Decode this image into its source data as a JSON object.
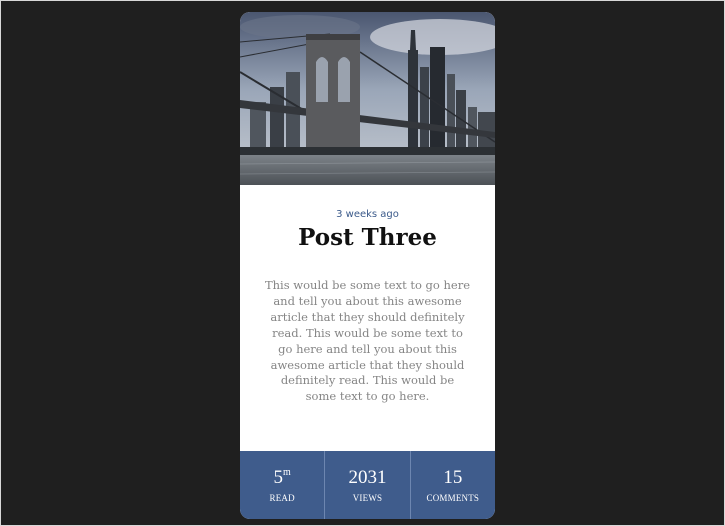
{
  "post": {
    "date": "3 weeks ago",
    "title": "Post Three",
    "body": "This would be some text to go here and tell you about this awesome article that they should definitely read. This would be some text to go here and tell you about this awesome article that they should definitely read. This would be some text to go here."
  },
  "stats": [
    {
      "value": "5",
      "unit": "m",
      "label": "READ"
    },
    {
      "value": "2031",
      "label": "VIEWS"
    },
    {
      "value": "15",
      "label": "COMMENTS"
    }
  ],
  "colors": {
    "page_background": "#202020",
    "card_background": "#ffffff",
    "stats_bar": "#3f5c8c",
    "date_text": "#3b5a8a",
    "body_text": "#858585"
  },
  "icons": {
    "hero_image": "brooklyn-bridge-city-skyline-photo"
  }
}
